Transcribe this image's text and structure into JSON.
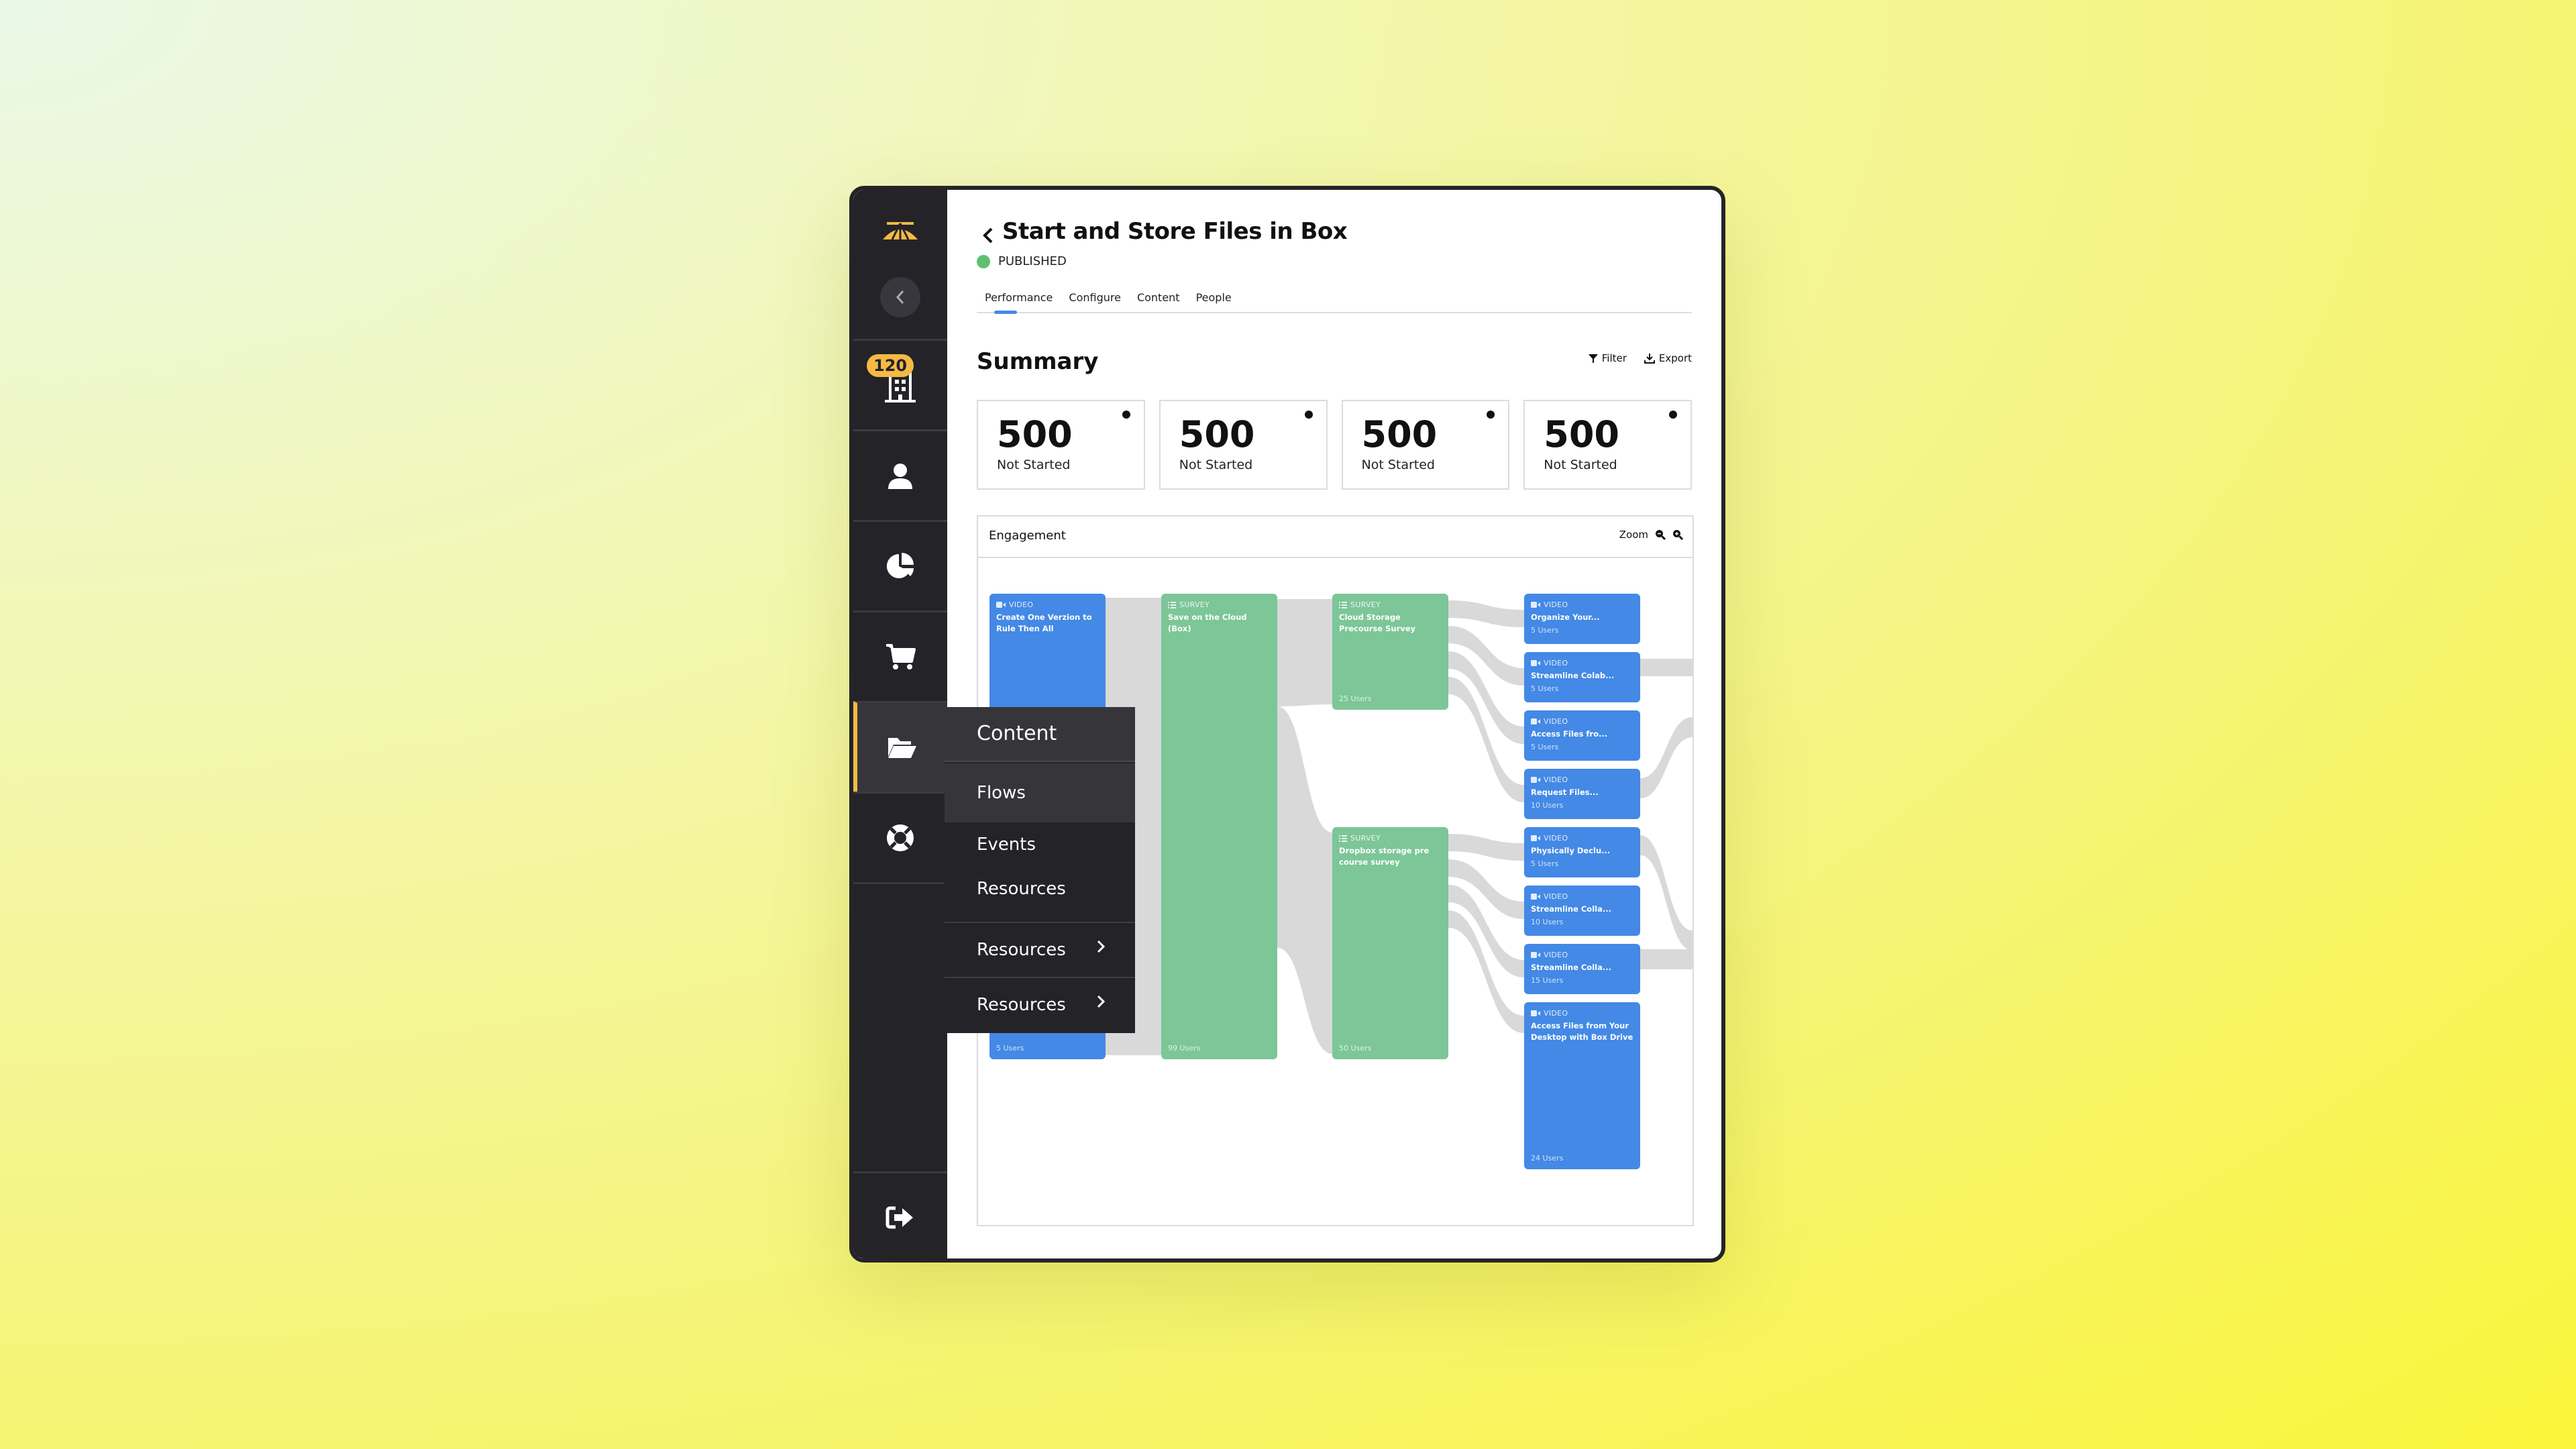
{
  "app": {
    "sidebar": {
      "logo": "parachute-logo",
      "collapse_icon": "chevron-left-icon",
      "items": [
        {
          "name": "organizations",
          "icon": "building-icon",
          "badge": "120"
        },
        {
          "name": "users",
          "icon": "user-icon"
        },
        {
          "name": "analytics",
          "icon": "pie-chart-icon"
        },
        {
          "name": "store",
          "icon": "cart-icon"
        },
        {
          "name": "content",
          "icon": "folder-open-icon",
          "active": true
        },
        {
          "name": "support",
          "icon": "lifebuoy-icon"
        }
      ],
      "logout_icon": "sign-out-icon"
    },
    "flyout": {
      "title": "Content",
      "items": [
        {
          "label": "Flows",
          "highlighted": true
        },
        {
          "label": "Events"
        },
        {
          "label": "Resources"
        },
        {
          "label": "Resources",
          "has_submenu": true
        },
        {
          "label": "Resources",
          "has_submenu": true
        }
      ]
    },
    "colors": {
      "accent": "#f5b944",
      "sidebar_bg": "#232328",
      "video": "#4389e5",
      "survey": "#7cc698",
      "published": "#5fc070",
      "tab_indicator": "#4389e5",
      "flow_link": "#d9d9d9"
    }
  },
  "header": {
    "title": "Start and Store Files in Box",
    "status": "PUBLISHED",
    "tabs": [
      {
        "label": "Performance",
        "active": true
      },
      {
        "label": "Configure"
      },
      {
        "label": "Content"
      },
      {
        "label": "People"
      }
    ]
  },
  "summary": {
    "title": "Summary",
    "filter_label": "Filter",
    "export_label": "Export",
    "cards": [
      {
        "value": "500",
        "label": "Not Started"
      },
      {
        "value": "500",
        "label": "Not Started"
      },
      {
        "value": "500",
        "label": "Not Started"
      },
      {
        "value": "500",
        "label": "Not Started"
      }
    ]
  },
  "engagement": {
    "title": "Engagement",
    "zoom_label": "Zoom",
    "nodes": [
      {
        "id": "n1",
        "col": 0,
        "type": "VIDEO",
        "name": "Create One Verzion to Rule Then All",
        "users": "5 Users"
      },
      {
        "id": "n2",
        "col": 1,
        "type": "SURVEY",
        "name": "Save on the Cloud (Box)",
        "users": "99 Users"
      },
      {
        "id": "n3",
        "col": 2,
        "type": "SURVEY",
        "name": "Cloud Storage Precourse Survey",
        "users": "25 Users"
      },
      {
        "id": "n4",
        "col": 2,
        "type": "SURVEY",
        "name": "Dropbox storage pre course survey",
        "users": "50 Users"
      },
      {
        "id": "n5",
        "col": 3,
        "type": "VIDEO",
        "name": "Organize Your...",
        "users": "5 Users"
      },
      {
        "id": "n6",
        "col": 3,
        "type": "VIDEO",
        "name": "Streamline Colab...",
        "users": "5 Users"
      },
      {
        "id": "n7",
        "col": 3,
        "type": "VIDEO",
        "name": "Access Files fro...",
        "users": "5 Users"
      },
      {
        "id": "n8",
        "col": 3,
        "type": "VIDEO",
        "name": "Request Files...",
        "users": "10 Users"
      },
      {
        "id": "n9",
        "col": 3,
        "type": "VIDEO",
        "name": "Physically Declu...",
        "users": "5 Users"
      },
      {
        "id": "n10",
        "col": 3,
        "type": "VIDEO",
        "name": "Streamline Colla...",
        "users": "10 Users"
      },
      {
        "id": "n11",
        "col": 3,
        "type": "VIDEO",
        "name": "Streamline Colla...",
        "users": "15 Users"
      },
      {
        "id": "n12",
        "col": 3,
        "type": "VIDEO",
        "name": "Access Files from Your Desktop with Box Drive",
        "users": "24 Users"
      }
    ],
    "links": [
      {
        "from": "n1",
        "to": "n2"
      },
      {
        "from": "n2",
        "to": "n3"
      },
      {
        "from": "n2",
        "to": "n4"
      },
      {
        "from": "n3",
        "to": "n5"
      },
      {
        "from": "n3",
        "to": "n6"
      },
      {
        "from": "n3",
        "to": "n7"
      },
      {
        "from": "n3",
        "to": "n8"
      },
      {
        "from": "n4",
        "to": "n9"
      },
      {
        "from": "n4",
        "to": "n10"
      },
      {
        "from": "n4",
        "to": "n11"
      },
      {
        "from": "n4",
        "to": "n12"
      }
    ]
  }
}
